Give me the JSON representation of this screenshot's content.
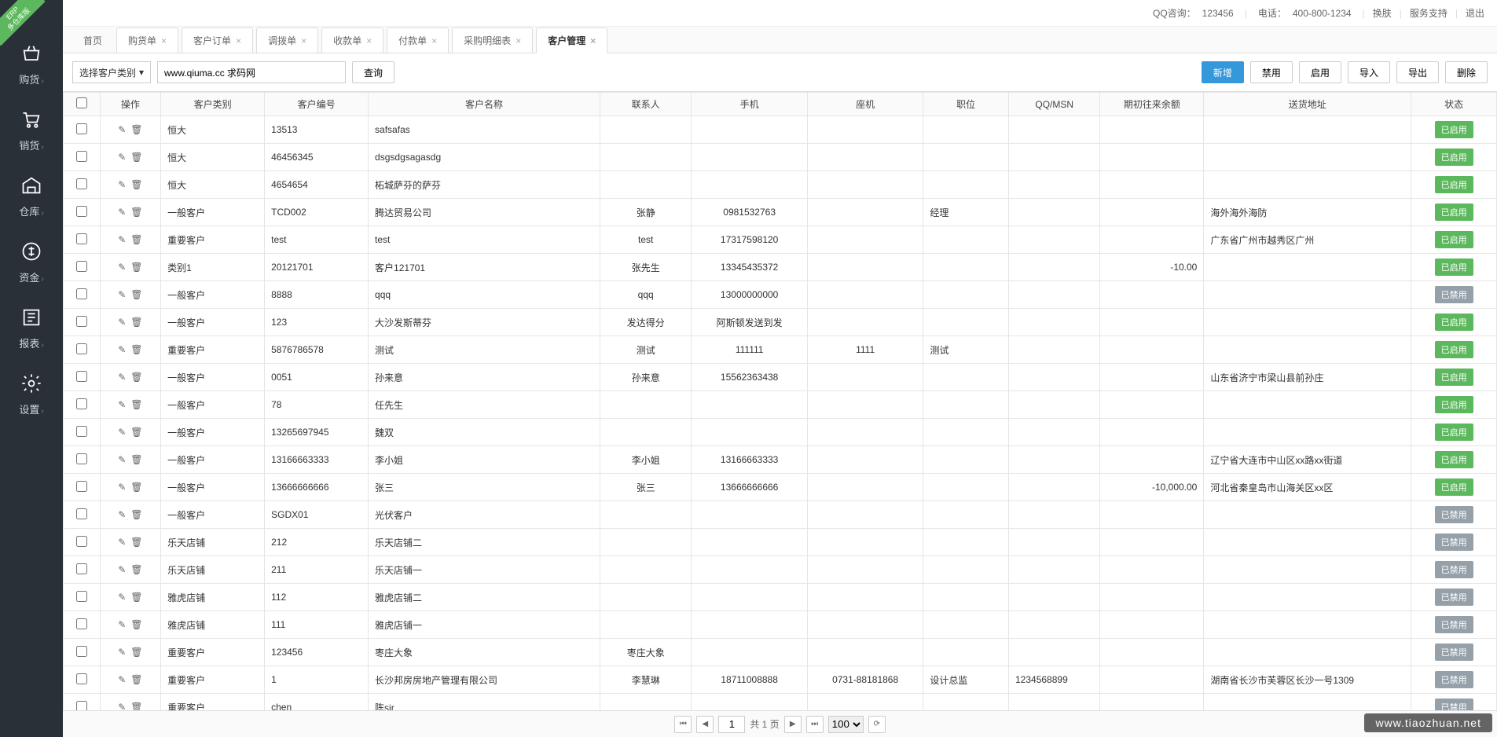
{
  "corner_badge": {
    "line1": "ERP",
    "line2": "多仓库版"
  },
  "topbar": {
    "qq_label": "QQ咨询：",
    "qq_value": "123456",
    "tel_label": "电话：",
    "tel_value": "400-800-1234",
    "skin": "换肤",
    "support": "服务支持",
    "logout": "退出"
  },
  "sidebar": [
    {
      "icon": "basket",
      "label": "购货"
    },
    {
      "icon": "cart",
      "label": "销货"
    },
    {
      "icon": "warehouse",
      "label": "仓库"
    },
    {
      "icon": "money",
      "label": "资金"
    },
    {
      "icon": "report",
      "label": "报表"
    },
    {
      "icon": "gear",
      "label": "设置"
    }
  ],
  "tabs": [
    {
      "label": "首页",
      "closable": false
    },
    {
      "label": "购货单",
      "closable": true
    },
    {
      "label": "客户订单",
      "closable": true
    },
    {
      "label": "调拨单",
      "closable": true
    },
    {
      "label": "收款单",
      "closable": true
    },
    {
      "label": "付款单",
      "closable": true
    },
    {
      "label": "采购明细表",
      "closable": true
    },
    {
      "label": "客户管理",
      "closable": true,
      "active": true
    }
  ],
  "filter": {
    "category_placeholder": "选择客户类别",
    "search_value": "www.qiuma.cc 求码网",
    "search_btn": "查询"
  },
  "actions": {
    "add": "新增",
    "disable": "禁用",
    "enable": "启用",
    "import": "导入",
    "export": "导出",
    "delete": "删除"
  },
  "columns": {
    "ops": "操作",
    "category": "客户类别",
    "code": "客户编号",
    "name": "客户名称",
    "contact": "联系人",
    "mobile": "手机",
    "tel": "座机",
    "position": "职位",
    "qq": "QQ/MSN",
    "balance": "期初往来余额",
    "address": "送货地址",
    "status": "状态"
  },
  "status_labels": {
    "enabled": "已启用",
    "disabled": "已禁用"
  },
  "rows": [
    {
      "category": "恒大",
      "code": "13513",
      "name": "safsafas",
      "contact": "",
      "mobile": "",
      "tel": "",
      "position": "",
      "qq": "",
      "balance": "",
      "address": "",
      "status": "enabled"
    },
    {
      "category": "恒大",
      "code": "46456345",
      "name": "dsgsdgsagasdg",
      "contact": "",
      "mobile": "",
      "tel": "",
      "position": "",
      "qq": "",
      "balance": "",
      "address": "",
      "status": "enabled"
    },
    {
      "category": "恒大",
      "code": "4654654",
      "name": "柘城萨芬的萨芬",
      "contact": "",
      "mobile": "",
      "tel": "",
      "position": "",
      "qq": "",
      "balance": "",
      "address": "",
      "status": "enabled"
    },
    {
      "category": "一般客户",
      "code": "TCD002",
      "name": "腾达贸易公司",
      "contact": "张静",
      "mobile": "0981532763",
      "tel": "",
      "position": "经理",
      "qq": "",
      "balance": "",
      "address": "海外海外海防",
      "status": "enabled"
    },
    {
      "category": "重要客户",
      "code": "test",
      "name": "test",
      "contact": "test",
      "mobile": "17317598120",
      "tel": "",
      "position": "",
      "qq": "",
      "balance": "",
      "address": "广东省广州市越秀区广州",
      "status": "enabled"
    },
    {
      "category": "类别1",
      "code": "20121701",
      "name": "客户121701",
      "contact": "张先生",
      "mobile": "13345435372",
      "tel": "",
      "position": "",
      "qq": "",
      "balance": "-10.00",
      "address": "",
      "status": "enabled"
    },
    {
      "category": "一般客户",
      "code": "8888",
      "name": "qqq",
      "contact": "qqq",
      "mobile": "13000000000",
      "tel": "",
      "position": "",
      "qq": "",
      "balance": "",
      "address": "",
      "status": "disabled"
    },
    {
      "category": "一般客户",
      "code": "123",
      "name": "大沙发斯蒂芬",
      "contact": "发达得分",
      "mobile": "阿斯顿发送到发",
      "tel": "",
      "position": "",
      "qq": "",
      "balance": "",
      "address": "",
      "status": "enabled"
    },
    {
      "category": "重要客户",
      "code": "5876786578",
      "name": "测试",
      "contact": "测试",
      "mobile": "111111",
      "tel": "1111",
      "position": "测试",
      "qq": "",
      "balance": "",
      "address": "",
      "status": "enabled"
    },
    {
      "category": "一般客户",
      "code": "0051",
      "name": "孙来意",
      "contact": "孙来意",
      "mobile": "15562363438",
      "tel": "",
      "position": "",
      "qq": "",
      "balance": "",
      "address": "山东省济宁市梁山县前孙庄",
      "status": "enabled"
    },
    {
      "category": "一般客户",
      "code": "78",
      "name": "任先生",
      "contact": "",
      "mobile": "",
      "tel": "",
      "position": "",
      "qq": "",
      "balance": "",
      "address": "",
      "status": "enabled"
    },
    {
      "category": "一般客户",
      "code": "13265697945",
      "name": "魏双",
      "contact": "",
      "mobile": "",
      "tel": "",
      "position": "",
      "qq": "",
      "balance": "",
      "address": "",
      "status": "enabled"
    },
    {
      "category": "一般客户",
      "code": "13166663333",
      "name": "李小姐",
      "contact": "李小姐",
      "mobile": "13166663333",
      "tel": "",
      "position": "",
      "qq": "",
      "balance": "",
      "address": "辽宁省大连市中山区xx路xx街道",
      "status": "enabled"
    },
    {
      "category": "一般客户",
      "code": "13666666666",
      "name": "张三",
      "contact": "张三",
      "mobile": "13666666666",
      "tel": "",
      "position": "",
      "qq": "",
      "balance": "-10,000.00",
      "address": "河北省秦皇岛市山海关区xx区",
      "status": "enabled"
    },
    {
      "category": "一般客户",
      "code": "SGDX01",
      "name": "光伏客户",
      "contact": "",
      "mobile": "",
      "tel": "",
      "position": "",
      "qq": "",
      "balance": "",
      "address": "",
      "status": "disabled"
    },
    {
      "category": "乐天店铺",
      "code": "212",
      "name": "乐天店铺二",
      "contact": "",
      "mobile": "",
      "tel": "",
      "position": "",
      "qq": "",
      "balance": "",
      "address": "",
      "status": "disabled"
    },
    {
      "category": "乐天店铺",
      "code": "211",
      "name": "乐天店铺一",
      "contact": "",
      "mobile": "",
      "tel": "",
      "position": "",
      "qq": "",
      "balance": "",
      "address": "",
      "status": "disabled"
    },
    {
      "category": "雅虎店铺",
      "code": "112",
      "name": "雅虎店铺二",
      "contact": "",
      "mobile": "",
      "tel": "",
      "position": "",
      "qq": "",
      "balance": "",
      "address": "",
      "status": "disabled"
    },
    {
      "category": "雅虎店铺",
      "code": "111",
      "name": "雅虎店铺一",
      "contact": "",
      "mobile": "",
      "tel": "",
      "position": "",
      "qq": "",
      "balance": "",
      "address": "",
      "status": "disabled"
    },
    {
      "category": "重要客户",
      "code": "123456",
      "name": "枣庄大象",
      "contact": "枣庄大象",
      "mobile": "",
      "tel": "",
      "position": "",
      "qq": "",
      "balance": "",
      "address": "",
      "status": "disabled"
    },
    {
      "category": "重要客户",
      "code": "1",
      "name": "长沙邦房房地产管理有限公司",
      "contact": "李慧琳",
      "mobile": "18711008888",
      "tel": "0731-88181868",
      "position": "设计总监",
      "qq": "1234568899",
      "balance": "",
      "address": "湖南省长沙市芙蓉区长沙一号1309",
      "status": "disabled"
    },
    {
      "category": "重要客户",
      "code": "chen",
      "name": "陈sir",
      "contact": "",
      "mobile": "",
      "tel": "",
      "position": "",
      "qq": "",
      "balance": "",
      "address": "",
      "status": "disabled"
    }
  ],
  "pager": {
    "page": "1",
    "total_label": "共 1 页",
    "page_size": "100"
  },
  "watermark": "www.tiaozhuan.net"
}
